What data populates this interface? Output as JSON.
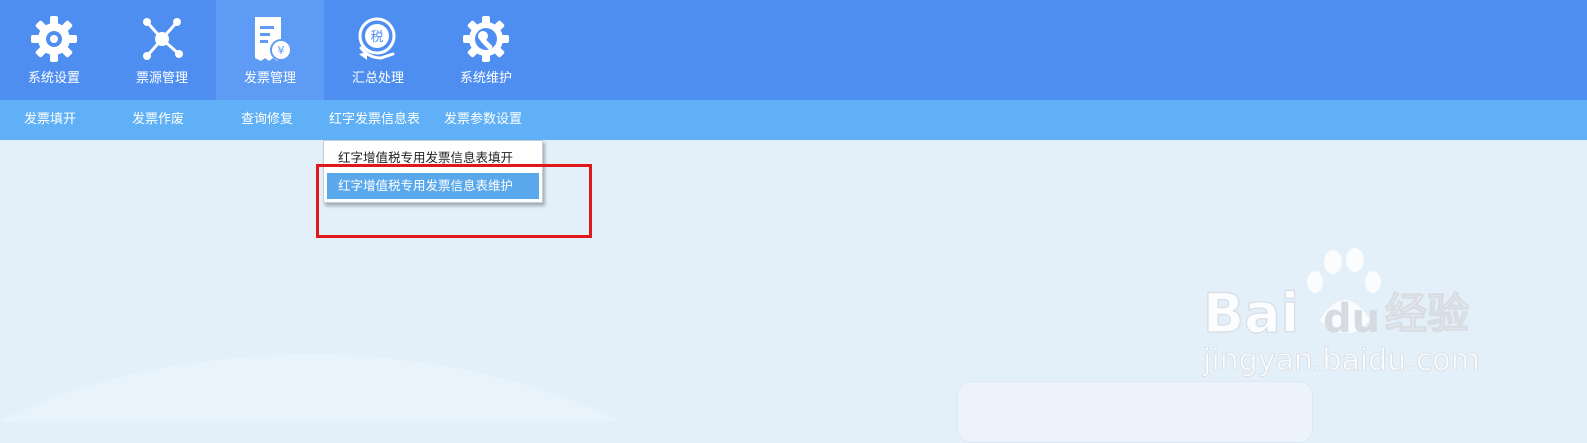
{
  "topnav": {
    "items": [
      {
        "label": "系统设置",
        "icon": "gear-icon"
      },
      {
        "label": "票源管理",
        "icon": "network-nodes-icon"
      },
      {
        "label": "发票管理",
        "icon": "invoice-yuan-icon",
        "active": true
      },
      {
        "label": "汇总处理",
        "icon": "tax-summary-icon"
      },
      {
        "label": "系统维护",
        "icon": "wrench-gear-icon"
      }
    ]
  },
  "subnav": {
    "items": [
      {
        "label": "发票填开"
      },
      {
        "label": "发票作废"
      },
      {
        "label": "查询修复"
      },
      {
        "label": "红字发票信息表"
      },
      {
        "label": "发票参数设置"
      }
    ]
  },
  "dropdown": {
    "items": [
      {
        "label": "红字增值税专用发票信息表填开"
      },
      {
        "label": "红字增值税专用发票信息表维护",
        "hovered": true
      }
    ]
  },
  "watermark": {
    "brand": "Bai du 经验",
    "url": "jingyan.baidu.com"
  },
  "colors": {
    "topbar": "#4f8ef1",
    "subbar": "#5fb0f6",
    "hover_item": "#5aa8ec",
    "highlight_border": "#e01818",
    "background": "#e3eff9"
  }
}
